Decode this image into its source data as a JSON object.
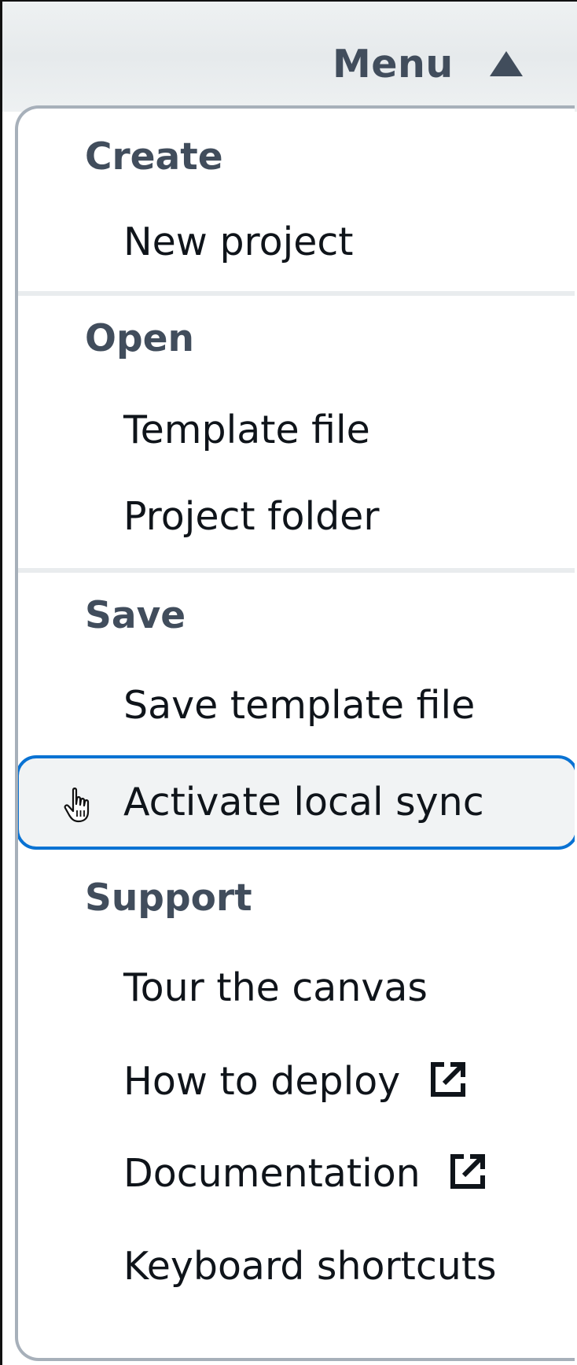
{
  "trigger": {
    "label": "Menu",
    "icon": "caret-up-icon"
  },
  "groups": [
    {
      "header": "Create",
      "items": [
        {
          "label": "New project"
        }
      ]
    },
    {
      "header": "Open",
      "items": [
        {
          "label": "Template file"
        },
        {
          "label": "Project folder"
        }
      ]
    },
    {
      "header": "Save",
      "items": [
        {
          "label": "Save template file"
        },
        {
          "label": "Activate local sync",
          "state": "hovered"
        }
      ]
    },
    {
      "header": "Support",
      "items": [
        {
          "label": "Tour the canvas"
        },
        {
          "label": "How to deploy",
          "icon": "external-link-icon"
        },
        {
          "label": "Documentation",
          "icon": "external-link-icon"
        },
        {
          "label": "Keyboard shortcuts"
        }
      ]
    }
  ],
  "colors": {
    "header_text": "#414d5c",
    "item_text": "#0f141a",
    "focus_ring": "#0972d3",
    "dropdown_border": "#a7b0ba"
  }
}
